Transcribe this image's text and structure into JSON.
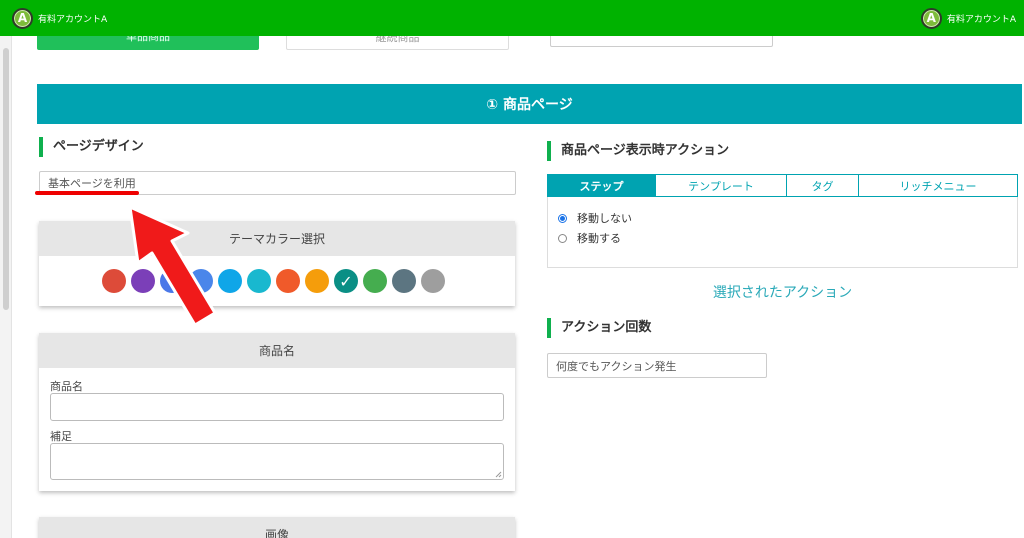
{
  "header": {
    "left_account": {
      "avatar_letter": "A",
      "name": "有料アカウントA"
    },
    "right_account": {
      "avatar_letter": "A",
      "name": "有料アカウントA"
    }
  },
  "top_buttons": {
    "left": "単品商品",
    "middle": "継続商品"
  },
  "banner_title": "① 商品ページ",
  "page_design": {
    "heading": "ページデザイン",
    "select_value": "基本ページを利用"
  },
  "theme_color": {
    "heading": "テーマカラー選択",
    "colors": [
      "#dd4b39",
      "#7b3fb8",
      "#4a78e8",
      "#4a86ea",
      "#0fa6e8",
      "#19b8cf",
      "#f05a2a",
      "#f59d0b",
      "#0a8f85",
      "#45ad4f",
      "#5c7581",
      "#9e9e9e"
    ],
    "selected_index": 8,
    "check_glyph": "✓"
  },
  "product_name_card": {
    "heading": "商品名",
    "name_label": "商品名",
    "supplement_label": "補足"
  },
  "image_card": {
    "heading": "画像"
  },
  "display_action": {
    "heading": "商品ページ表示時アクション",
    "tabs": [
      "ステップ",
      "テンプレート",
      "タグ",
      "リッチメニュー"
    ],
    "active_tab": 0,
    "radios": [
      {
        "label": "移動しない",
        "checked": true
      },
      {
        "label": "移動する",
        "checked": false
      }
    ],
    "selected_action_link": "選択されたアクション"
  },
  "action_count": {
    "heading": "アクション回数",
    "select_value": "何度でもアクション発生"
  },
  "colors": {
    "topbar": "#00b200",
    "banner": "#00a3b1",
    "accent_bar": "#0fb04e",
    "arrow": "#f01a1a"
  }
}
